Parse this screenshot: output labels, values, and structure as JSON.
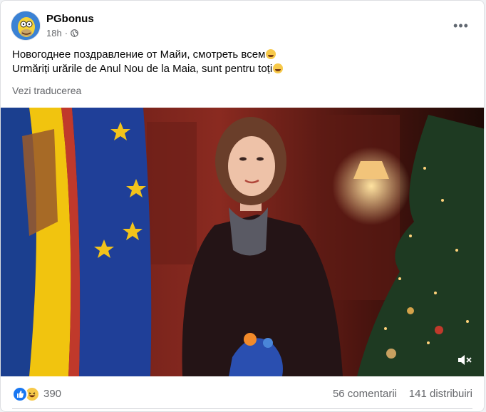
{
  "post": {
    "author": "PGbonus",
    "time": "18h",
    "separator": "·",
    "more_label": "•••",
    "text_line1": "Новогоднее поздравление от Майи, смотреть всем",
    "text_line2": "Urmăriți urările de Anul Nou de la Maia, sunt pentru toți",
    "translate_label": "Vezi traducerea"
  },
  "footer": {
    "reaction_count": "390",
    "comments": "56 comentarii",
    "shares": "141 distribuiri"
  },
  "colors": {
    "like": "#1877f2",
    "haha": "#f7c94a",
    "muted_text": "#65676b"
  }
}
